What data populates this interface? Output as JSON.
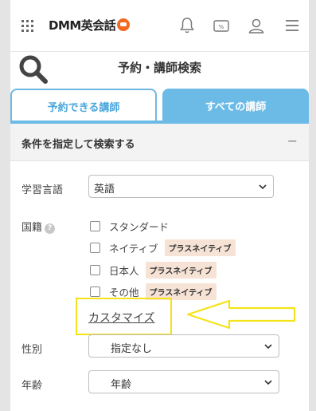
{
  "header": {
    "brand": "DMM英会話",
    "icons": [
      "grid-menu-icon",
      "bell-icon",
      "coupon-icon",
      "user-icon",
      "hamburger-icon"
    ]
  },
  "page": {
    "title": "予約・講師検索"
  },
  "tabs": [
    {
      "label": "予約できる講師",
      "active": false
    },
    {
      "label": "すべての講師",
      "active": true
    }
  ],
  "conditions": {
    "header": "条件を指定して検索する",
    "toggle": "−",
    "language": {
      "label": "学習言語",
      "value": "英語"
    },
    "nationality": {
      "label": "国籍",
      "help": "?",
      "options": [
        {
          "label": "スタンダード",
          "badge": "",
          "checked": false
        },
        {
          "label": "ネイティブ",
          "badge": "プラスネイティブ",
          "checked": false
        },
        {
          "label": "日本人",
          "badge": "プラスネイティブ",
          "checked": false
        },
        {
          "label": "その他",
          "badge": "プラスネイティブ",
          "checked": false
        }
      ],
      "customize": "カスタマイズ"
    },
    "gender": {
      "label": "性別",
      "value": "指定なし"
    },
    "age": {
      "label": "年齢",
      "value": "年齢"
    }
  },
  "colors": {
    "tab_accent": "#6cbbe6",
    "highlight": "#f5e31a",
    "badge_bg": "#f6e3d6",
    "brand_orange": "#f26a21"
  }
}
